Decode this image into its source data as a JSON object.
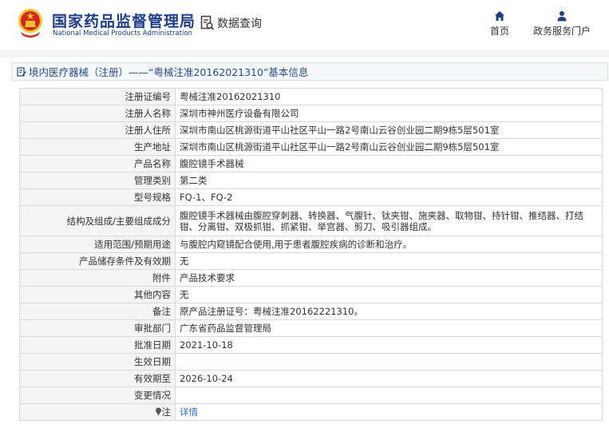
{
  "header": {
    "logo_cn": "国家药品监督管理局",
    "logo_en": "National Medical Products Administration",
    "data_query": "数据查询",
    "nav": {
      "home": "首页",
      "portal": "政务服务门户"
    }
  },
  "breadcrumb": "境内医疗器械（注册）——“粤械注准20162021310”基本信息",
  "rows": [
    {
      "label": "注册证编号",
      "value": "粤械注准20162021310"
    },
    {
      "label": "注册人名称",
      "value": "深圳市神州医疗设备有限公司"
    },
    {
      "label": "注册人住所",
      "value": "深圳市南山区桃源街道平山社区平山一路2号南山云谷创业园二期9栋5层501室"
    },
    {
      "label": "生产地址",
      "value": "深圳市南山区桃源街道平山社区平山一路2号南山云谷创业园二期9栋5层501室"
    },
    {
      "label": "产品名称",
      "value": "腹腔镜手术器械"
    },
    {
      "label": "管理类别",
      "value": "第二类"
    },
    {
      "label": "型号规格",
      "value": "FQ-1、FQ-2"
    },
    {
      "label": "结构及组成/主要组成成分",
      "value": "腹腔镜手术器械由腹腔穿刺器、转换器、气腹针、钛夹钳、施夹器、取物钳、持针钳、推结器、打结钳、分离钳、双极抓钳、抓紧钳、举宫器、剪刀、吸引器组成。"
    },
    {
      "label": "适用范围/预期用途",
      "value": "与腹腔内窥镜配合使用,用于患者腹腔疾病的诊断和治疗。"
    },
    {
      "label": "产品储存条件及有效期",
      "value": "无"
    },
    {
      "label": "附件",
      "value": "产品技术要求"
    },
    {
      "label": "其他内容",
      "value": "无"
    },
    {
      "label": "备注",
      "value": "原产品注册证号：粤械注准20162221310。"
    },
    {
      "label": "审批部门",
      "value": "广东省药品监督管理局"
    },
    {
      "label": "批准日期",
      "value": "2021-10-18"
    },
    {
      "label": "生效日期",
      "value": ""
    },
    {
      "label": "有效期至",
      "value": "2026-10-24"
    },
    {
      "label": "变更情况",
      "value": ""
    }
  ],
  "note": {
    "label": "注",
    "link": "详情"
  },
  "colors": {
    "brand": "#1d3d8a",
    "link": "#2f6fb8",
    "emblem_red": "#d7261e",
    "emblem_gold": "#f2c230"
  }
}
